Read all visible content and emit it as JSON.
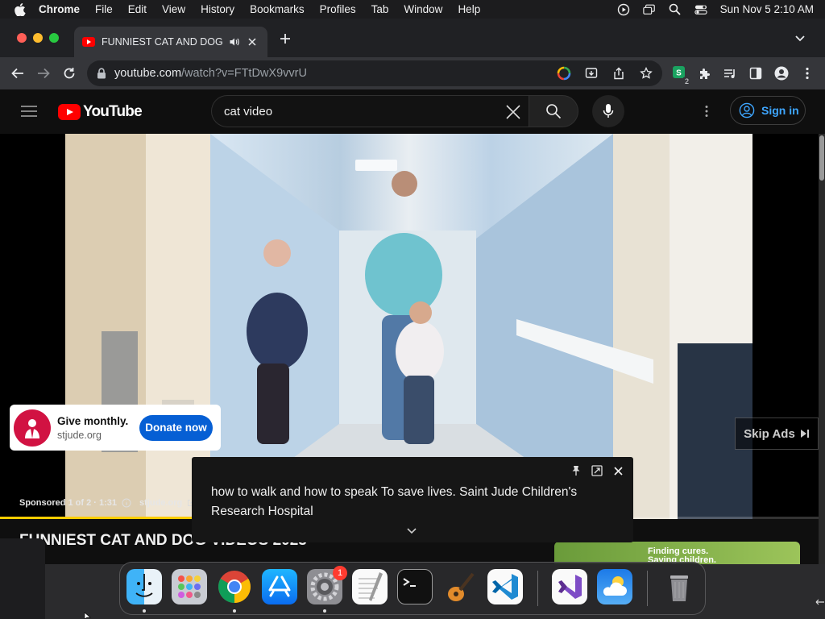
{
  "menubar": {
    "items": [
      "Chrome",
      "File",
      "Edit",
      "View",
      "History",
      "Bookmarks",
      "Profiles",
      "Tab",
      "Window",
      "Help"
    ],
    "clock": "Sun Nov 5  2:10 AM"
  },
  "browser": {
    "tab_title": "FUNNIEST CAT AND DOG",
    "url_host": "youtube.com",
    "url_path": "/watch?v=FTtDwX9vvrU",
    "extension_badge": "2"
  },
  "youtube": {
    "logo_text": "YouTube",
    "search_value": "cat video",
    "signin_label": "Sign in"
  },
  "ad": {
    "card_title": "Give monthly.",
    "card_domain": "stjude.org",
    "donate_label": "Donate now",
    "skip_label": "Skip Ads",
    "sponsored": "Sponsored 1 of 2 · 1:31",
    "advertiser_link": "stjude.org",
    "progress": 0.24
  },
  "caption": {
    "text": "how to walk and how to speak To save lives. Saint Jude Children's Research Hospital"
  },
  "video": {
    "title": "FUNNIEST CAT AND DOG VIDEOS 2023",
    "promo_line1": "Finding cures.",
    "promo_line2": "Saving children."
  },
  "dock": {
    "apps": [
      "Finder",
      "Launchpad",
      "Google Chrome",
      "App Store",
      "System Settings",
      "TextEdit",
      "Terminal",
      "GarageBand",
      "Visual Studio Code",
      "Visual Studio",
      "Weather",
      "Trash"
    ],
    "settings_badge": "1"
  },
  "colors": {
    "youtube_red": "#ff0000",
    "link_blue": "#3ea6ff",
    "donate_blue": "#065fd4",
    "stjude_red": "#d11242",
    "ad_progress": "#ffcc00"
  }
}
